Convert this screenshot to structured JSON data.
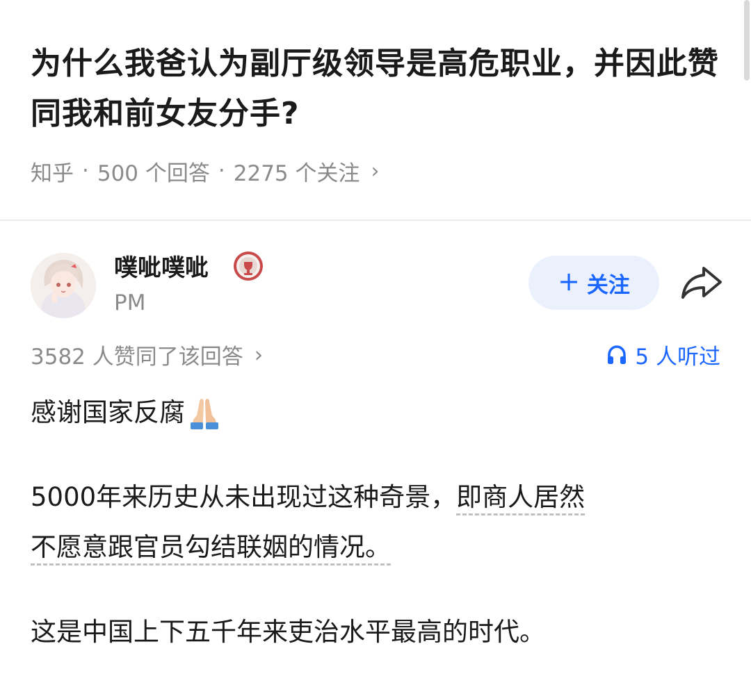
{
  "question": {
    "title": "为什么我爸认为副厅级领导是高危职业，并因此赞同我和前女友分手?",
    "meta": {
      "source": "知乎",
      "separator": "·",
      "answers": "500 个回答",
      "followers": "2275 个关注",
      "chevron": "›"
    }
  },
  "author": {
    "name": "噗呲噗呲",
    "bio": "PM",
    "badge_icon": "medal-icon",
    "avatar_icon": "avatar-anime-girl"
  },
  "actions": {
    "follow_plus": "+",
    "follow_label": "关注",
    "share_icon": "share-arrow-icon"
  },
  "stats": {
    "upvotes": "3582 人赞同了该回答",
    "chevron": "›",
    "listened": "5 人听过",
    "listened_icon": "headphones-icon"
  },
  "answer": {
    "p1": "感谢国家反腐",
    "p1_emoji": "folded-hands-emoji",
    "p2_part1": "5000年来历史从未出现过这种奇景，",
    "p2_part2": "即商人居然",
    "p2_part3": "不愿意跟官员勾结联姻的情况。",
    "p3": "这是中国上下五千年来吏治水平最高的时代。"
  },
  "colors": {
    "accent": "#1a66ff",
    "follow_bg": "#eaf1fd",
    "text": "#1a1a1a",
    "secondary": "#8a8a8a"
  }
}
